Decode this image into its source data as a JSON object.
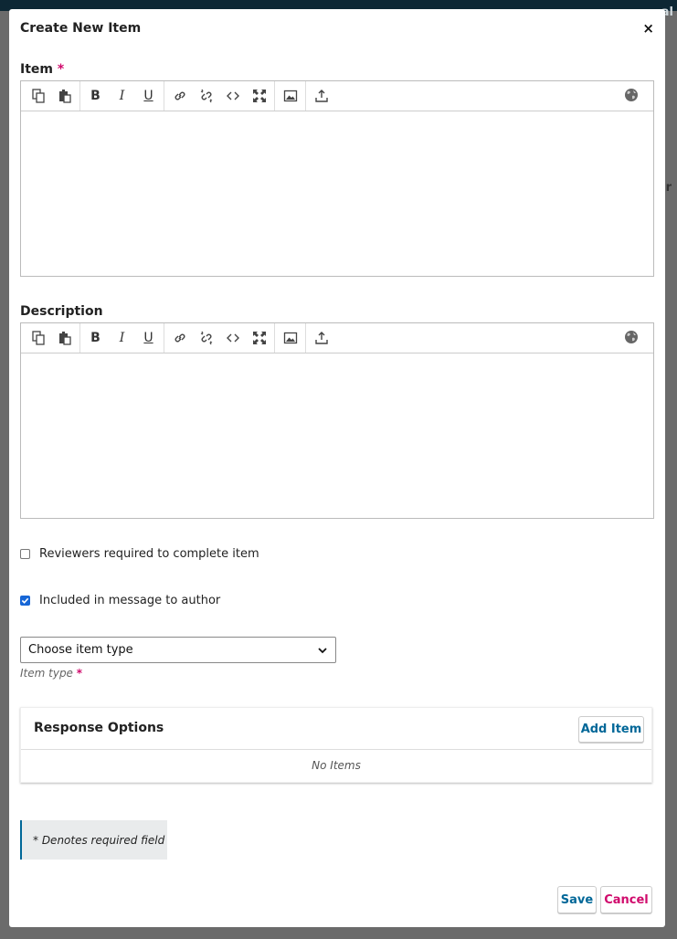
{
  "topbar": {
    "partial_label": "al"
  },
  "backdrop": {
    "partial_text": "r"
  },
  "modal": {
    "title": "Create New Item",
    "close_glyph": "×"
  },
  "item_field": {
    "label": "Item",
    "required_mark": "*"
  },
  "description_field": {
    "label": "Description"
  },
  "toolbar": {
    "tools": [
      "copy-icon",
      "paste-icon",
      "bold",
      "italic",
      "underline",
      "link-icon",
      "unlink-icon",
      "code-icon",
      "fullscreen-icon",
      "image-icon",
      "upload-icon",
      "globe-icon"
    ],
    "bold_glyph": "B",
    "italic_glyph": "I",
    "underline_glyph": "U"
  },
  "checkboxes": [
    {
      "label": "Reviewers required to complete item",
      "checked": false
    },
    {
      "label": "Included in message to author",
      "checked": true
    }
  ],
  "item_type": {
    "selected": "Choose item type",
    "description": "Item type",
    "required_mark": "*"
  },
  "response_options": {
    "title": "Response Options",
    "add_label": "Add Item",
    "empty_text": "No Items"
  },
  "required_note": "* Denotes required field",
  "footer": {
    "save_label": "Save",
    "cancel_label": "Cancel"
  },
  "colors": {
    "link": "#006798",
    "required": "#d00a6c",
    "checkbox": "#1766d6",
    "topbar": "#0d2734"
  }
}
